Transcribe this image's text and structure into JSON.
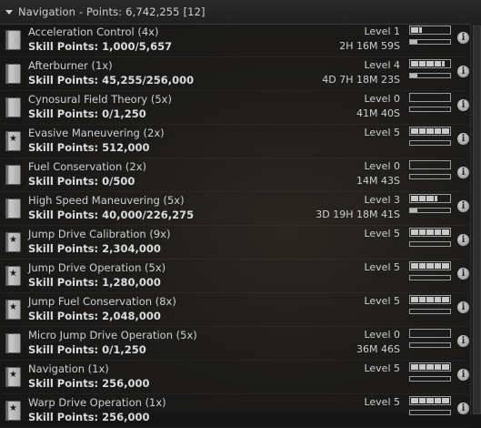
{
  "header": {
    "group": "Navigation",
    "points_label": "- Points:",
    "points": "6,742,255",
    "count": "[12]"
  },
  "skills": [
    {
      "name": "Acceleration Control (4x)",
      "sp_label": "Skill Points:",
      "sp": "1,000/5,657",
      "level": "Level 1",
      "trained": 1,
      "time": "2H 16M 59S",
      "progress": 0.18,
      "icon": "book-icon"
    },
    {
      "name": "Afterburner (1x)",
      "sp_label": "Skill Points:",
      "sp": "45,255/256,000",
      "level": "Level 4",
      "trained": 4,
      "time": "4D 7H 18M 23S",
      "progress": 0.18,
      "icon": "book-icon"
    },
    {
      "name": "Cynosural Field Theory (5x)",
      "sp_label": "Skill Points:",
      "sp": "0/1,250",
      "level": "Level 0",
      "trained": 0,
      "time": "41M 40S",
      "progress": 0,
      "icon": "book-icon"
    },
    {
      "name": "Evasive Maneuvering (2x)",
      "sp_label": "Skill Points:",
      "sp": "512,000",
      "level": "Level 5",
      "trained": 5,
      "time": "",
      "progress": null,
      "icon": "star-book-icon"
    },
    {
      "name": "Fuel Conservation (2x)",
      "sp_label": "Skill Points:",
      "sp": "0/500",
      "level": "Level 0",
      "trained": 0,
      "time": "14M 43S",
      "progress": 0,
      "icon": "book-icon"
    },
    {
      "name": "High Speed Maneuvering (5x)",
      "sp_label": "Skill Points:",
      "sp": "40,000/226,275",
      "level": "Level 3",
      "trained": 3,
      "time": "3D 19H 18M 41S",
      "progress": 0.18,
      "icon": "book-icon"
    },
    {
      "name": "Jump Drive Calibration (9x)",
      "sp_label": "Skill Points:",
      "sp": "2,304,000",
      "level": "Level 5",
      "trained": 5,
      "time": "",
      "progress": null,
      "icon": "star-book-icon"
    },
    {
      "name": "Jump Drive Operation (5x)",
      "sp_label": "Skill Points:",
      "sp": "1,280,000",
      "level": "Level 5",
      "trained": 5,
      "time": "",
      "progress": null,
      "icon": "star-book-icon"
    },
    {
      "name": "Jump Fuel Conservation (8x)",
      "sp_label": "Skill Points:",
      "sp": "2,048,000",
      "level": "Level 5",
      "trained": 5,
      "time": "",
      "progress": null,
      "icon": "star-book-icon"
    },
    {
      "name": "Micro Jump Drive Operation (5x)",
      "sp_label": "Skill Points:",
      "sp": "0/1,250",
      "level": "Level 0",
      "trained": 0,
      "time": "36M 46S",
      "progress": 0,
      "icon": "book-icon"
    },
    {
      "name": "Navigation (1x)",
      "sp_label": "Skill Points:",
      "sp": "256,000",
      "level": "Level 5",
      "trained": 5,
      "time": "",
      "progress": null,
      "icon": "star-book-icon"
    },
    {
      "name": "Warp Drive Operation (1x)",
      "sp_label": "Skill Points:",
      "sp": "256,000",
      "level": "Level 5",
      "trained": 5,
      "time": "",
      "progress": null,
      "icon": "star-book-icon"
    }
  ]
}
